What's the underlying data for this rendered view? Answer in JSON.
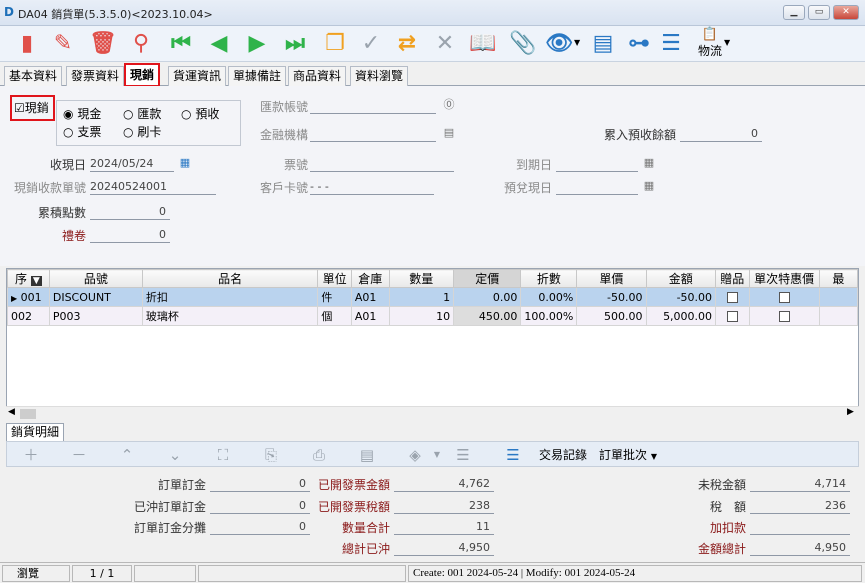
{
  "window": {
    "title": "DA04 銷貨單(5.3.5.0)<2023.10.04>"
  },
  "toolbar": {
    "logistics_label": "物流"
  },
  "tabs": [
    "基本資料",
    "發票資料",
    "現銷",
    "貨運資訊",
    "單據備註",
    "商品資料",
    "資料瀏覽"
  ],
  "cash": {
    "checkbox_label": "現銷",
    "pay_methods": [
      "現金",
      "匯款",
      "預收",
      "支票",
      "刷卡"
    ],
    "remit_account_label": "匯款帳號",
    "bank_label": "金融機構",
    "accum_prepay_label": "累入預收餘額",
    "accum_prepay_value": "0",
    "receipt_date_label": "收現日",
    "receipt_date": "2024/05/24",
    "bill_no_label": "票號",
    "due_date_label": "到期日",
    "receipt_no_label": "現銷收款單號",
    "receipt_no": "20240524001",
    "card_no_label": "客戶卡號",
    "card_no": "-   -   -",
    "redeem_date_label": "預兌現日",
    "points_label": "累積點數",
    "points_value": "0",
    "coupon_label": "禮卷",
    "coupon_value": "0"
  },
  "grid": {
    "columns": [
      "序",
      "品號",
      "品名",
      "單位",
      "倉庫",
      "數量",
      "定價",
      "折數",
      "單價",
      "金額",
      "贈品",
      "單次特惠價",
      "最"
    ],
    "rows": [
      {
        "seq": "001",
        "code": "DISCOUNT",
        "name": "折扣",
        "unit": "件",
        "wh": "A01",
        "qty": "1",
        "list": "0.00",
        "disc": "0.00%",
        "price": "-50.00",
        "amount": "-50.00"
      },
      {
        "seq": "002",
        "code": "P003",
        "name": "玻璃杯",
        "unit": "個",
        "wh": "A01",
        "qty": "10",
        "list": "450.00",
        "disc": "100.00%",
        "price": "500.00",
        "amount": "5,000.00"
      }
    ]
  },
  "subtab": {
    "label": "銷貨明細"
  },
  "subtoolbar": {
    "trade_record": "交易記錄",
    "order_batch": "訂單批次"
  },
  "summary": {
    "order_deposit_label": "訂單訂金",
    "order_deposit": "0",
    "offset_deposit_label": "已沖訂單訂金",
    "offset_deposit": "0",
    "deposit_alloc_label": "訂單訂金分攤",
    "deposit_alloc": "0",
    "invoiced_amount_label": "已開發票金額",
    "invoiced_amount": "4,762",
    "invoiced_tax_label": "已開發票稅額",
    "invoiced_tax": "238",
    "qty_total_label": "數量合計",
    "qty_total": "11",
    "total_offset_label": "總計已沖",
    "total_offset": "4,950",
    "pretax_label": "未稅金額",
    "pretax": "4,714",
    "tax_label": "稅　額",
    "tax": "236",
    "surcharge_label": "加扣款",
    "surcharge": "",
    "grand_total_label": "金額總計",
    "grand_total": "4,950"
  },
  "status": {
    "mode": "瀏覽",
    "page": "1 / 1",
    "audit": "Create: 001 2024-05-24 | Modify: 001 2024-05-24"
  }
}
